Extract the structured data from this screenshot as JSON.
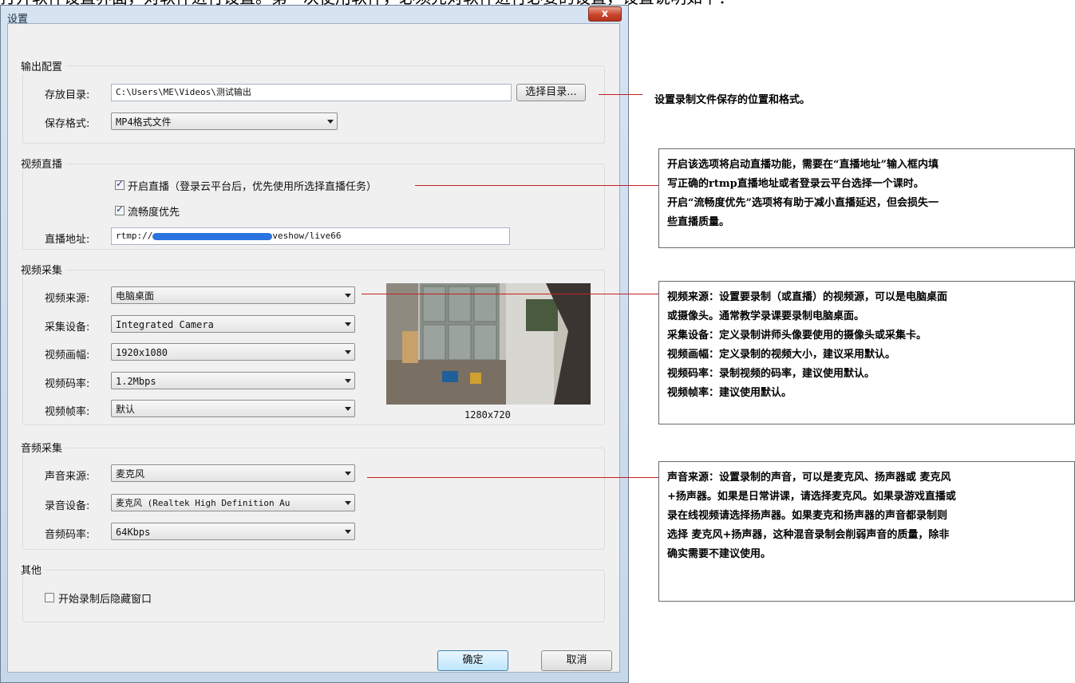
{
  "caption": "打开软件设置界面，对软件进行设置。第一次使用软件，必须先对软件进行必要的设置，设置说明如下：",
  "window": {
    "title": "设置",
    "close_label": "x"
  },
  "output": {
    "group_title": "输出配置",
    "dir_label": "存放目录:",
    "dir_value": "C:\\Users\\ME\\Videos\\测试输出",
    "browse_label": "选择目录...",
    "format_label": "保存格式:",
    "format_value": "MP4格式文件"
  },
  "live": {
    "group_title": "视频直播",
    "enable_label": "开启直播（登录云平台后，优先使用所选择直播任务）",
    "enable_checked": true,
    "smooth_label": "流畅度优先",
    "smooth_checked": true,
    "url_label": "直播地址:",
    "url_prefix": "rtmp://",
    "url_suffix": "veshow/live66"
  },
  "video": {
    "group_title": "视频采集",
    "source_label": "视频来源:",
    "source_value": "电脑桌面",
    "device_label": "采集设备:",
    "device_value": "Integrated Camera",
    "size_label": "视频画幅:",
    "size_value": "1920x1080",
    "bitrate_label": "视频码率:",
    "bitrate_value": "1.2Mbps",
    "fps_label": "视频帧率:",
    "fps_value": "默认",
    "preview_resolution": "1280x720"
  },
  "audio": {
    "group_title": "音频采集",
    "source_label": "声音来源:",
    "source_value": "麦克风",
    "device_label": "录音设备:",
    "device_value": "麦克风 (Realtek High Definition Au",
    "bitrate_label": "音频码率:",
    "bitrate_value": "64Kbps"
  },
  "other": {
    "group_title": "其他",
    "hide_label": "开始录制后隐藏窗口",
    "hide_checked": false
  },
  "buttons": {
    "ok": "确定",
    "cancel": "取消"
  },
  "notes": {
    "output": "设置录制文件保存的位置和格式。",
    "live": [
      "开启该选项将启动直播功能，需要在“直播地址”输入框内填",
      "写正确的rtmp直播地址或者登录云平台选择一个课时。",
      "开启“流畅度优先”选项将有助于减小直播延迟，但会损失一",
      "些直播质量。"
    ],
    "video": [
      "视频来源：设置要录制（或直播）的视频源，可以是电脑桌面",
      "或摄像头。通常教学录课要录制电脑桌面。",
      "采集设备：定义录制讲师头像要使用的摄像头或采集卡。",
      "视频画幅：定义录制的视频大小，建议采用默认。",
      "视频码率：录制视频的码率，建议使用默认。",
      "视频帧率：建议使用默认。"
    ],
    "audio": [
      "声音来源：设置录制的声音，可以是麦克风、扬声器或 麦克风",
      "+扬声器。如果是日常讲课，请选择麦克风。如果录游戏直播或",
      "录在线视频请选择扬声器。如果麦克和扬声器的声音都录制则",
      "选择 麦克风+扬声器，这种混音录制会削弱声音的质量，除非",
      "确实需要不建议使用。"
    ]
  }
}
